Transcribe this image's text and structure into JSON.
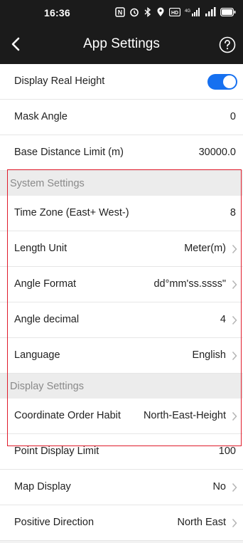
{
  "status_bar": {
    "time": "16:36"
  },
  "app_bar": {
    "title": "App Settings",
    "back_icon": "chevron-left-icon",
    "help_icon": "question-circle-icon"
  },
  "rows_top": [
    {
      "label": "Display Real Height",
      "type": "toggle",
      "enabled": true
    },
    {
      "label": "Mask Angle",
      "value": "0"
    },
    {
      "label": "Base Distance Limit (m)",
      "value": "30000.0"
    }
  ],
  "system_settings": {
    "header": "System Settings",
    "rows": [
      {
        "label": "Time Zone (East+ West-)",
        "value": "8"
      },
      {
        "label": "Length Unit",
        "value": "Meter(m)"
      },
      {
        "label": "Angle Format",
        "value": "dd°mm'ss.ssss\""
      },
      {
        "label": "Angle decimal",
        "value": "4"
      },
      {
        "label": "Language",
        "value": "English"
      }
    ]
  },
  "display_settings": {
    "header": "Display Settings",
    "rows": [
      {
        "label": "Coordinate Order Habit",
        "value": "North-East-Height"
      },
      {
        "label": "Point Display Limit",
        "value": "100"
      },
      {
        "label": "Map Display",
        "value": "No"
      },
      {
        "label": "Positive Direction",
        "value": "North East"
      }
    ]
  },
  "colors": {
    "bar_background": "#1b1b1b",
    "toggle_on": "#1670f0",
    "highlight_border": "#e01b2a"
  }
}
